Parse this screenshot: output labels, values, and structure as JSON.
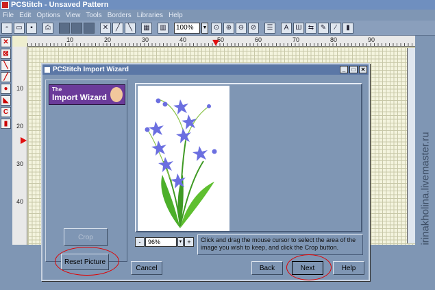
{
  "window": {
    "title": "PCStitch - Unsaved Pattern"
  },
  "menu": [
    "File",
    "Edit",
    "Options",
    "View",
    "Tools",
    "Borders",
    "Libraries",
    "Help"
  ],
  "toolbar": {
    "zoom": "100%"
  },
  "ruler": {
    "top_labels": [
      "10",
      "20",
      "30",
      "40",
      "50",
      "60",
      "70",
      "80",
      "90"
    ],
    "left_labels": [
      "10",
      "20",
      "30",
      "40"
    ]
  },
  "dialog": {
    "title": "PCStitch Import Wizard",
    "banner_the": "The",
    "banner_title": "Import Wizard",
    "crop_label": "Crop",
    "reset_label": "Reset Picture",
    "cancel_label": "Cancel",
    "back_label": "Back",
    "next_label": "Next",
    "help_label": "Help",
    "zoom_value": "96%",
    "zoom_minus": "-",
    "zoom_plus": "+",
    "instruction": "Click and drag the mouse cursor to select the area of the image you wish to keep, and click the Crop button."
  },
  "watermark": "irinakholina.livemaster.ru",
  "colors": {
    "annotation": "#e00000",
    "accent": "#5b77a6",
    "flower": "#6b6fe0",
    "stem": "#3f9a24"
  }
}
